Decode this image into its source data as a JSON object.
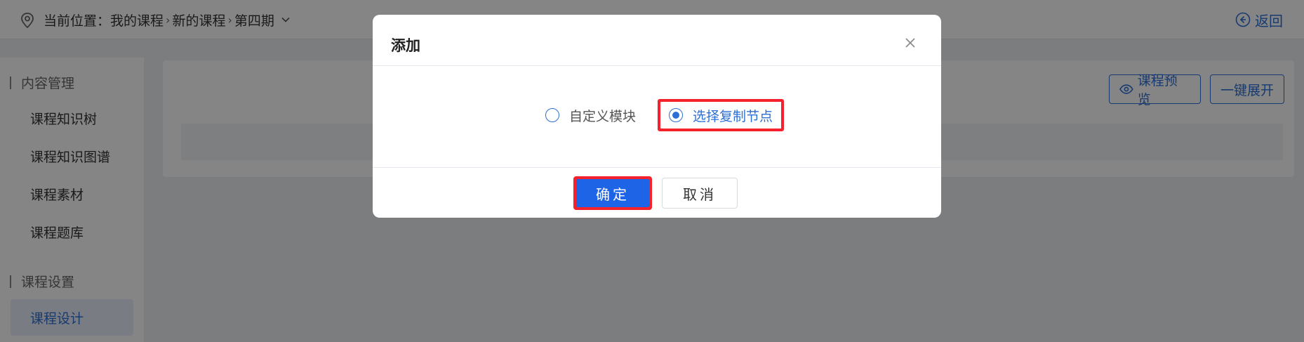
{
  "header": {
    "location_label": "当前位置：",
    "crumbs": [
      "我的课程",
      "新的课程",
      "第四期"
    ],
    "back_label": "返回"
  },
  "sidebar": {
    "section1": "内容管理",
    "items1": [
      "课程知识树",
      "课程知识图谱",
      "课程素材",
      "课程题库"
    ],
    "section2": "课程设置",
    "items2": [
      "课程设计"
    ]
  },
  "toolbar": {
    "preview_label": "课程预览",
    "expand_label": "一键展开"
  },
  "modal": {
    "title": "添加",
    "options": [
      {
        "label": "自定义模块",
        "checked": false
      },
      {
        "label": "选择复制节点",
        "checked": true
      }
    ],
    "confirm_label": "确定",
    "cancel_label": "取消"
  },
  "colors": {
    "accent": "#2d6fd6",
    "primary_button": "#1d65e6",
    "highlight": "#f5222d"
  }
}
